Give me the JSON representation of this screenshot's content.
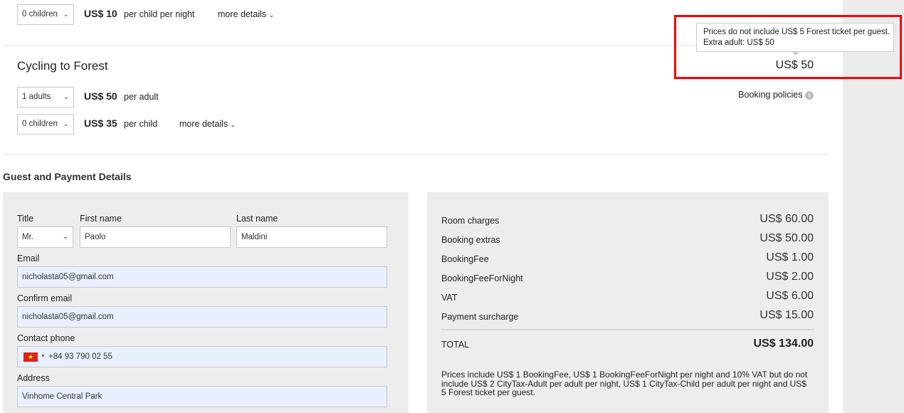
{
  "prev_extra": {
    "children_select": "0 children",
    "child_price": "US$ 10",
    "child_unit": "per child per night",
    "more_details": "more details"
  },
  "cycling": {
    "title": "Cycling to Forest",
    "adults_select": "1 adults",
    "adult_price": "US$ 50",
    "adult_unit": "per adult",
    "children_select": "0 children",
    "child_price": "US$ 35",
    "child_unit": "per child",
    "more_details": "more details",
    "total_price": "US$ 50",
    "tooltip_line1": "Prices do not include US$ 5 Forest ticket per guest.",
    "tooltip_line2": "Extra adult: US$ 50",
    "booking_policies": "Booking policies"
  },
  "guest": {
    "heading": "Guest and Payment Details",
    "title_label": "Title",
    "title_value": "Mr.",
    "first_name_label": "First name",
    "first_name_value": "Paolo",
    "last_name_label": "Last name",
    "last_name_value": "Maldini",
    "email_label": "Email",
    "email_value": "nicholasta05@gmail.com",
    "confirm_email_label": "Confirm email",
    "confirm_email_value": "nicholasta05@gmail.com",
    "phone_label": "Contact phone",
    "phone_value": "+84 93 790 02 55",
    "address_label": "Address",
    "address_value": "Vinhome Central Park"
  },
  "summary": {
    "rows": [
      {
        "label": "Room charges",
        "value": "US$ 60.00"
      },
      {
        "label": "Booking extras",
        "value": "US$ 50.00"
      },
      {
        "label": "BookingFee",
        "value": "US$ 1.00"
      },
      {
        "label": "BookingFeeForNight",
        "value": "US$ 2.00"
      },
      {
        "label": "VAT",
        "value": "US$ 6.00"
      },
      {
        "label": "Payment surcharge",
        "value": "US$ 15.00"
      }
    ],
    "total_label": "TOTAL",
    "total_value": "US$ 134.00",
    "note": "Prices include US$ 1 BookingFee, US$ 1 BookingFeeForNight per night and 10% VAT but do not include US$ 2 CityTax-Adult per adult per night, US$ 1 CityTax-Child per adult per night and US$ 5 Forest ticket per guest."
  },
  "colors": {
    "highlight": "#ff0000",
    "panel": "#ededed",
    "autofill": "#e8f0fe"
  }
}
